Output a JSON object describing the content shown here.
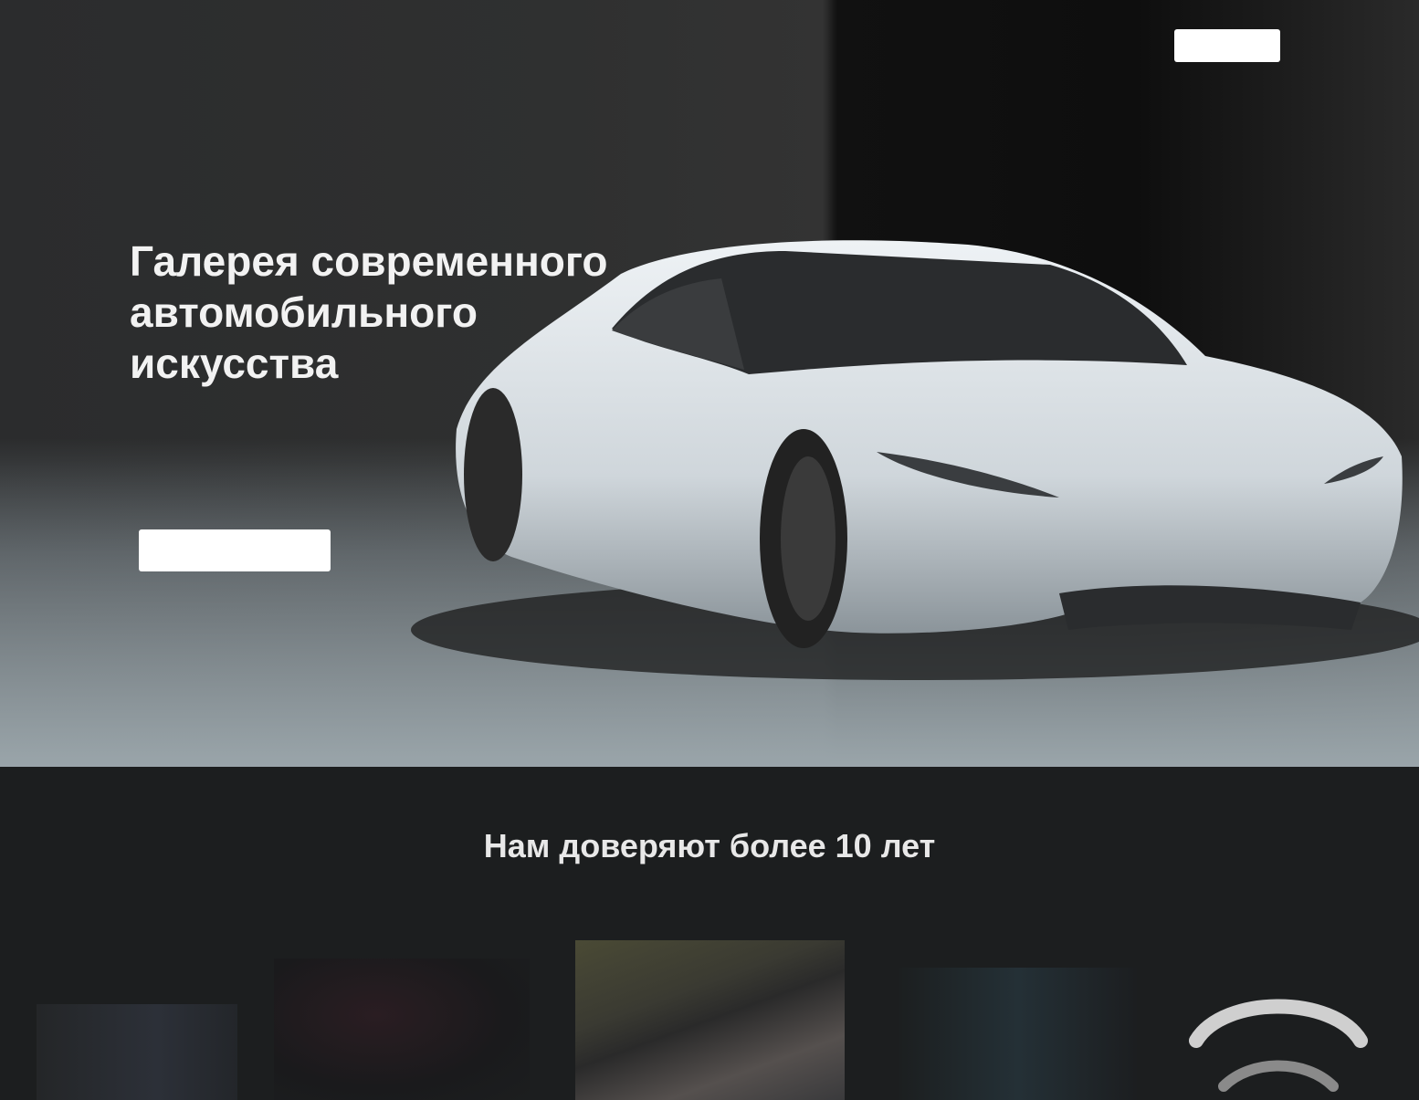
{
  "header": {
    "logo_mark": "",
    "logo_line1": "",
    "logo_line2": "",
    "nav_link": "",
    "nav_button": ""
  },
  "hero": {
    "title": "Галерея современного автомобильного искусства",
    "subtitle": "",
    "button": ""
  },
  "trust": {
    "title": "Нам доверяют более 10 лет"
  },
  "brands": [
    {
      "label": ""
    },
    {
      "label": ""
    },
    {
      "label": ""
    },
    {
      "label": ""
    },
    {
      "label": ""
    }
  ],
  "colors": {
    "page_background": "#1c1e1f",
    "accent_button": "#ffffff",
    "car_body": "#e3e8ec"
  }
}
